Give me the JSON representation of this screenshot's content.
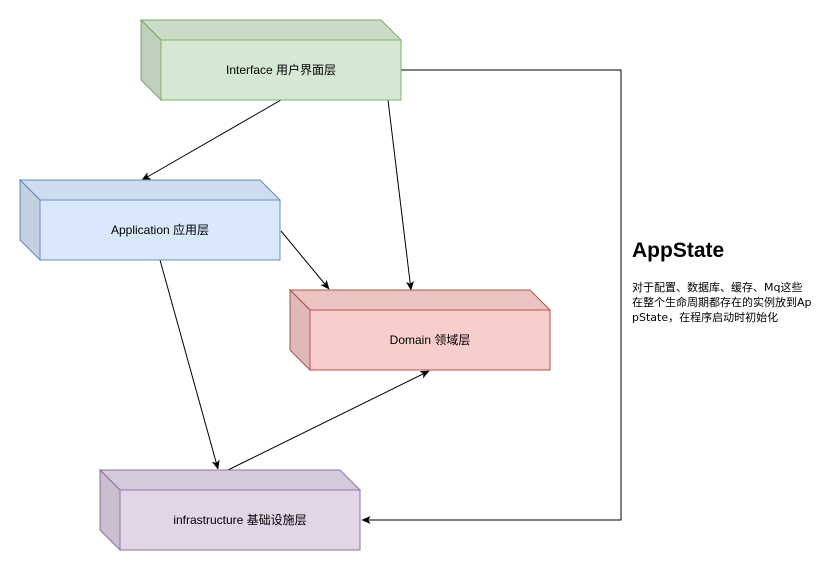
{
  "colors": {
    "interface": {
      "fill": "#d5e8d4",
      "stroke": "#82b366"
    },
    "application": {
      "fill": "#dae8fc",
      "stroke": "#6c8ebf"
    },
    "domain": {
      "fill": "#f8cecc",
      "stroke": "#b85450"
    },
    "infrastructure": {
      "fill": "#e1d5e7",
      "stroke": "#9673a6"
    },
    "edge": "#000000"
  },
  "layers": {
    "interface": {
      "label": "Interface 用户界面层"
    },
    "application": {
      "label": "Application 应用层"
    },
    "domain": {
      "label": "Domain 领域层"
    },
    "infrastructure": {
      "label": "infrastructure 基础设施层"
    }
  },
  "edges": [
    {
      "from": "interface",
      "to": "application"
    },
    {
      "from": "interface",
      "to": "domain"
    },
    {
      "from": "application",
      "to": "domain"
    },
    {
      "from": "application",
      "to": "infrastructure"
    },
    {
      "from": "infrastructure",
      "to": "domain"
    },
    {
      "from": "interface",
      "to": "infrastructure"
    }
  ],
  "appstate": {
    "title": "AppState",
    "description": "对于配置、数据库、缓存、Mq这些在整个生命周期都存在的实例放到AppState，在程序启动时初始化"
  }
}
